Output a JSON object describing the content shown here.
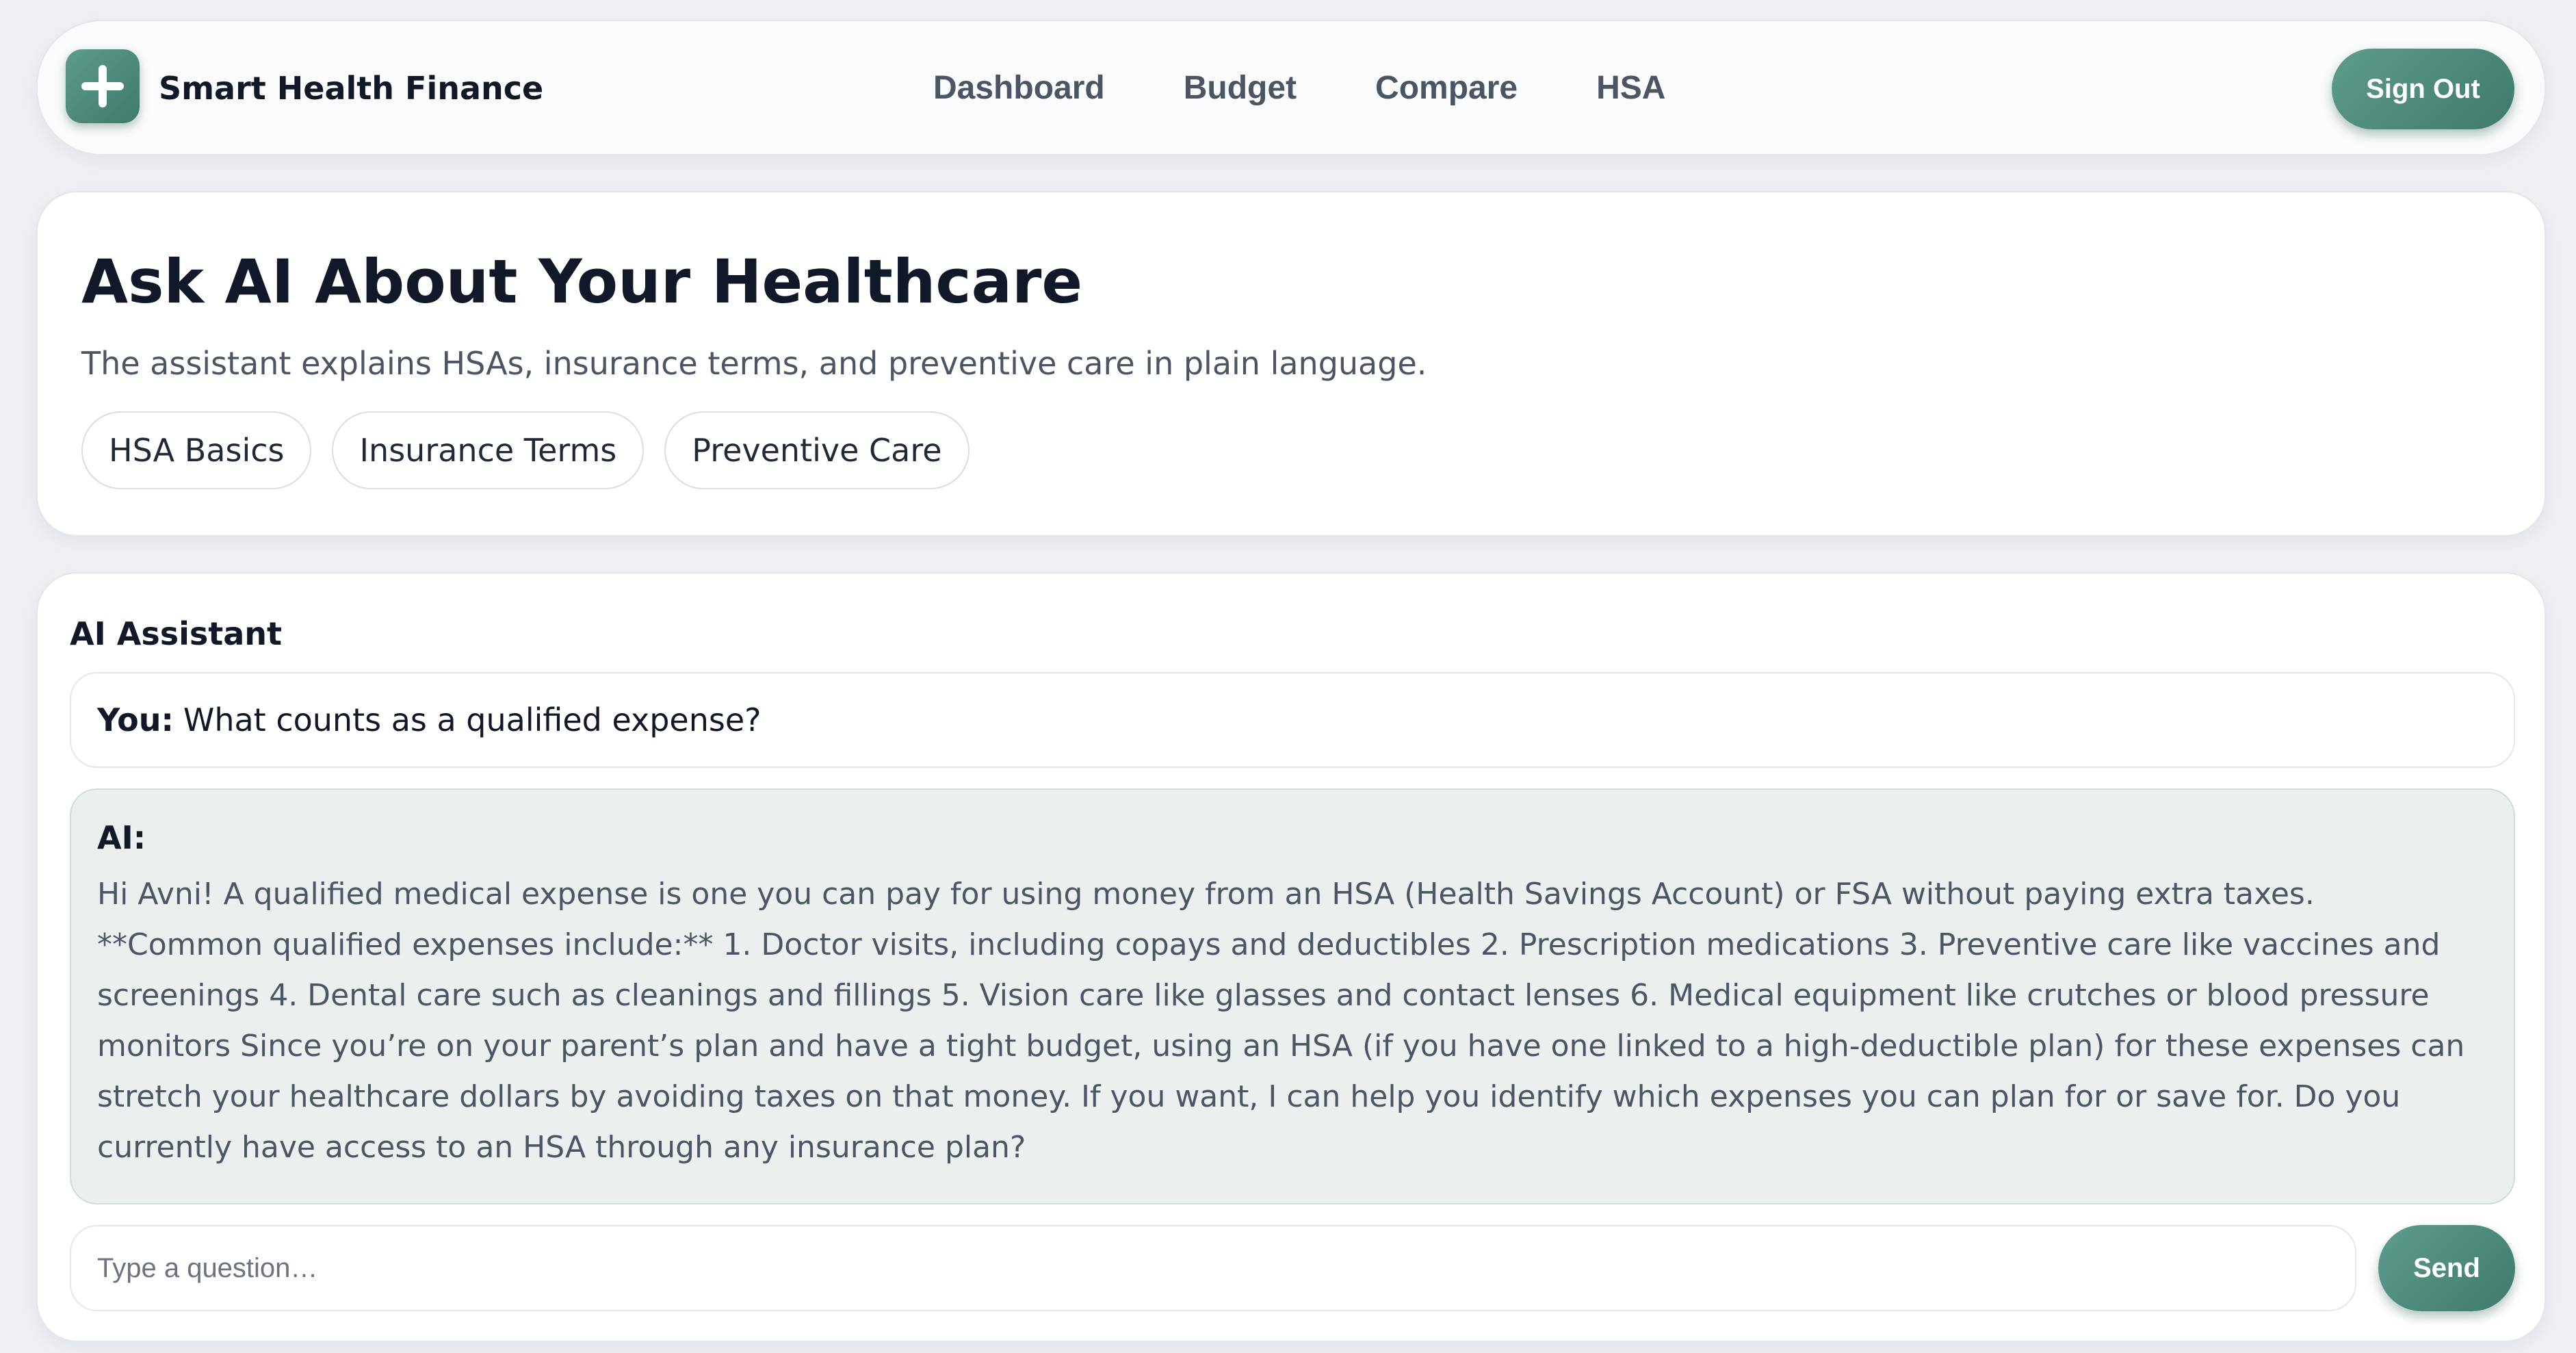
{
  "header": {
    "brand": "Smart Health Finance",
    "logo_icon": "plus-icon",
    "nav": [
      "Dashboard",
      "Budget",
      "Compare",
      "HSA"
    ],
    "sign_out": "Sign Out"
  },
  "hero": {
    "title": "Ask AI About Your Healthcare",
    "subtitle": "The assistant explains HSAs, insurance terms, and preventive care in plain language.",
    "chips": [
      "HSA Basics",
      "Insurance Terms",
      "Preventive Care"
    ]
  },
  "chat": {
    "heading": "AI Assistant",
    "user_label": "You:",
    "user_message": "What counts as a qualified expense?",
    "ai_label": "AI:",
    "ai_message": "Hi Avni! A qualified medical expense is one you can pay for using money from an HSA (Health Savings Account) or FSA without paying extra taxes. **Common qualified expenses include:** 1. Doctor visits, including copays and deductibles 2. Prescription medications 3. Preventive care like vaccines and screenings 4. Dental care such as cleanings and fillings 5. Vision care like glasses and contact lenses 6. Medical equipment like crutches or blood pressure monitors Since you’re on your parent’s plan and have a tight budget, using an HSA (if you have one linked to a high-deductible plan) for these expenses can stretch your healthcare dollars by avoiding taxes on that money. If you want, I can help you identify which expenses you can plan for or save for. Do you currently have access to an HSA through any insurance plan?",
    "input_placeholder": "Type a question…",
    "input_value": "",
    "send": "Send"
  },
  "colors": {
    "accent": "#4f8b7c",
    "accent_dark": "#3f7a6c",
    "ai_bubble": "#ebf0ef",
    "background": "#eef0f4"
  }
}
